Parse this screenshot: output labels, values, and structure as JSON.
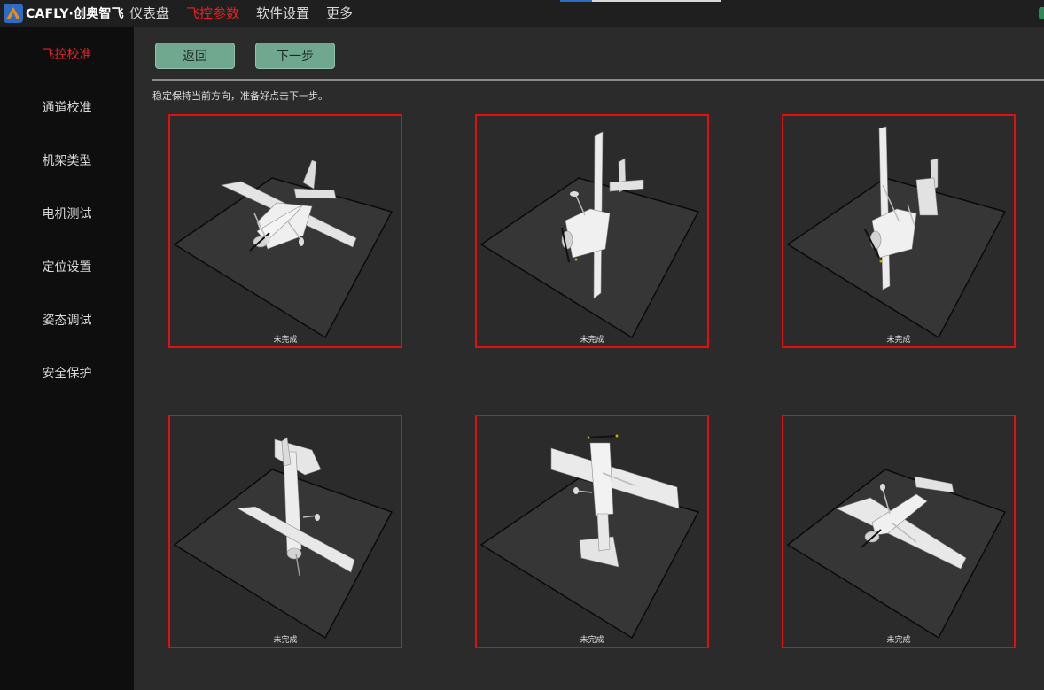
{
  "app": {
    "logo_text": "CAFLY·创奥智飞"
  },
  "topnav": {
    "items": [
      {
        "label": "仪表盘"
      },
      {
        "label": "飞控参数",
        "active": true
      },
      {
        "label": "软件设置"
      },
      {
        "label": "更多"
      }
    ]
  },
  "sidebar": {
    "items": [
      {
        "label": "飞控校准",
        "active": true
      },
      {
        "label": "通道校准"
      },
      {
        "label": "机架类型"
      },
      {
        "label": "电机测试"
      },
      {
        "label": "定位设置"
      },
      {
        "label": "姿态调试"
      },
      {
        "label": "安全保护"
      }
    ]
  },
  "toolbar": {
    "back_label": "返回",
    "next_label": "下一步"
  },
  "instruction": "稳定保持当前方向，准备好点击下一步。",
  "calibration": {
    "panels": [
      {
        "status": "未完成"
      },
      {
        "status": "未完成"
      },
      {
        "status": "未完成"
      },
      {
        "status": "未完成"
      },
      {
        "status": "未完成"
      },
      {
        "status": "未完成"
      }
    ]
  },
  "colors": {
    "accent_active": "#e0262a",
    "panel_border": "#e01010",
    "button_bg": "#6fa88e",
    "background": "#2b2b2b",
    "sidebar_bg": "#0e0e0e"
  }
}
